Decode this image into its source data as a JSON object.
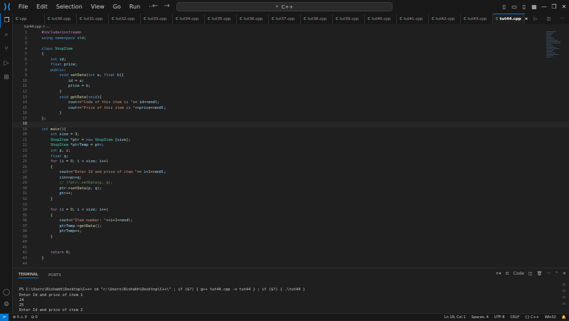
{
  "titlebar": {
    "menu": [
      "File",
      "Edit",
      "Selection",
      "View",
      "Go",
      "Run",
      "···"
    ],
    "back_icon": "←",
    "forward_icon": "→",
    "search_text": "C++",
    "window_controls": [
      "—",
      "❐",
      "✕"
    ]
  },
  "tabs": [
    "cpp",
    "tut30.cpp",
    "tut31.cpp",
    "tut32.cpp",
    "tut33.cpp",
    "tut34.cpp",
    "tut35.cpp",
    "tut36.cpp",
    "tut37.cpp",
    "tut38.cpp",
    "tut39.cpp",
    "tut40.cpp",
    "tut41.cpp",
    "tut42.cpp",
    "tut43.cpp",
    "tut44.cpp"
  ],
  "active_tab_close": "×",
  "breadcrumb": "tut44.cpp > ...",
  "editor": {
    "current_line": 18,
    "lines": [
      "    #include<iostream>",
      "    using namespace std;",
      "",
      "    class ShopItem",
      "    {",
      "        int id;",
      "        float price;",
      "        public:",
      "            void setData(int a, float b){",
      "                id = a;",
      "                price = b;",
      "            }",
      "            void getData(void){",
      "                cout<<\"Code of this item is \"<< id<<endl;",
      "                cout<<\"Price of this item is \"<<price<<endl;",
      "            }",
      "    };",
      "",
      "    int main(){",
      "        int size = 3;",
      "        ShopItem *ptr = new ShopItem [size];",
      "        ShopItem *ptrTemp = ptr;",
      "        int p, i;",
      "        float q;",
      "        for (i = 0; i < size; i++)",
      "        {",
      "            cout<<\"Enter Id and price of item \"<< i+1<<endl;",
      "            cin>>p>>q;",
      "            // (*ptr).setData(p, q);",
      "            ptr->setData(p, q);",
      "            ptr++;",
      "        }",
      "",
      "        for (i = 0; i < size; i++)",
      "        {",
      "            cout<<\"Item number: \"<<i+1<<endl;",
      "            ptrTemp->getData();",
      "            ptrTemp++;",
      "        }",
      "",
      "",
      "        return 0;",
      "    }",
      ""
    ]
  },
  "panel": {
    "tabs": [
      "TERMINAL",
      "PORTS"
    ],
    "terminal_name": "Code",
    "terminal_lines": [
      "",
      "PS C:\\Users\\Rishabh\\Desktop\\C++> cd \"c:\\Users\\Rishabh\\Desktop\\C++\\\" ; if ($?) { g++ tut44.cpp -o tut44 } ; if ($?) { .\\tut44 }",
      "Enter Id and price of item 1",
      "24",
      "25",
      "Enter Id and price of item 2"
    ]
  },
  "statusbar": {
    "errors": "0",
    "warnings": "0",
    "ports": "0",
    "position": "Ln 18, Col 1",
    "spaces": "Spaces: 4",
    "encoding": "UTF-8",
    "eol": "CRLF",
    "language": "C++",
    "platform": "Win32"
  },
  "icons": {
    "explorer": "explorer-icon",
    "search": "search-icon",
    "source_control": "source-control-icon",
    "run_debug": "run-debug-icon",
    "extensions": "extensions-icon",
    "account": "account-icon",
    "settings": "gear-icon"
  },
  "colors": {
    "accent": "#0078d4",
    "editor_bg": "#1f1f1f",
    "chrome_bg": "#181818"
  }
}
